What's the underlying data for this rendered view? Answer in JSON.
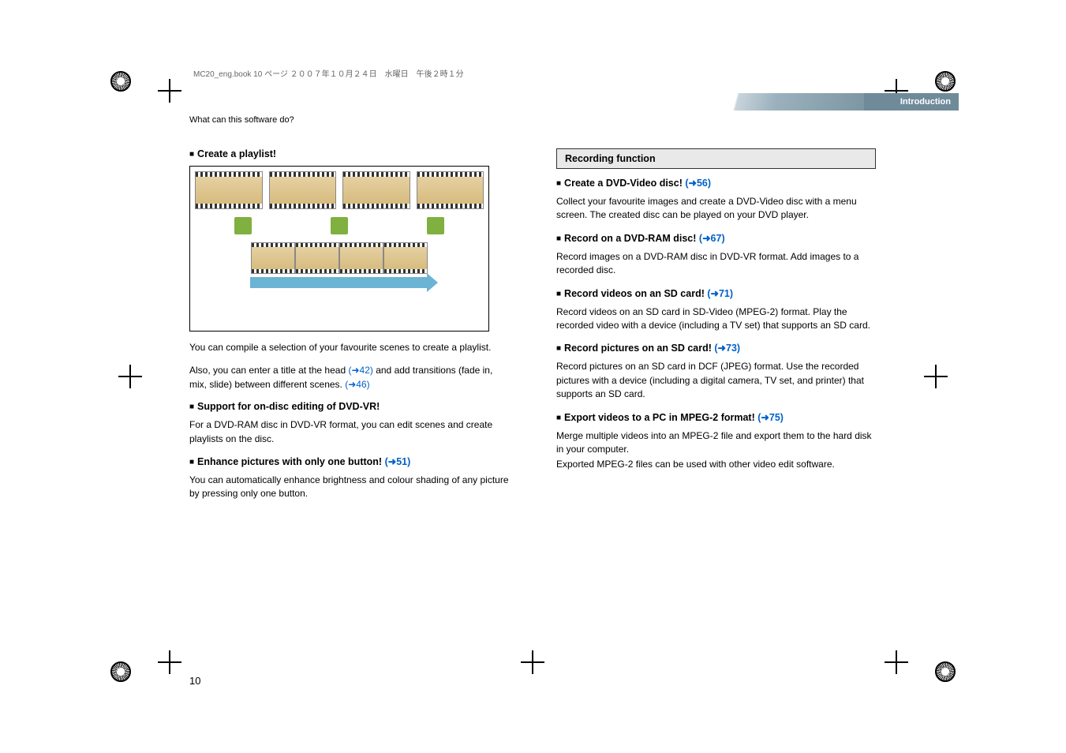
{
  "header_line": "MC20_eng.book  10 ページ  ２００７年１０月２４日　水曜日　午後２時１分",
  "banner_label": "Introduction",
  "breadcrumb": "What can this software do?",
  "page_number": "10",
  "left": {
    "h1": "Create a playlist!",
    "p1a": "You can compile a selection of your favourite scenes to create a playlist.",
    "p1b_pre": "Also, you can enter a title at the head ",
    "p1b_link1": "(➜42)",
    "p1b_mid": " and add transitions (fade in, mix, slide) between different scenes. ",
    "p1b_link2": "(➜46)",
    "h2": "Support for on-disc editing of DVD-VR!",
    "p2": "For a DVD-RAM disc in DVD-VR format, you can edit scenes and create playlists on the disc.",
    "h3_pre": "Enhance pictures with only one button! ",
    "h3_link": "(➜51)",
    "p3": "You can automatically enhance brightness and colour shading of any picture by pressing only one button."
  },
  "right": {
    "section_title": "Recording function",
    "h1_pre": "Create a DVD-Video disc! ",
    "h1_link": "(➜56)",
    "p1": "Collect your favourite images and create a DVD-Video disc with a menu screen. The created disc can be played on your DVD player.",
    "h2_pre": "Record on a DVD-RAM disc! ",
    "h2_link": "(➜67)",
    "p2": "Record images on a DVD-RAM disc in DVD-VR format. Add images to a recorded disc.",
    "h3_pre": "Record videos on an SD card! ",
    "h3_link": "(➜71)",
    "p3": "Record videos on an SD card in SD-Video (MPEG-2) format. Play the recorded video with a device (including a TV set) that supports an SD card.",
    "h4_pre": "Record pictures on an SD card! ",
    "h4_link": "(➜73)",
    "p4": "Record pictures on an SD card in DCF (JPEG) format. Use the recorded pictures with a device (including a digital camera, TV set, and printer) that supports an SD card.",
    "h5_pre": "Export videos to a PC in MPEG-2 format! ",
    "h5_link": "(➜75)",
    "p5a": "Merge multiple videos into an MPEG-2 file and export them to the hard disk in your computer.",
    "p5b": "Exported MPEG-2 files can be used with other video edit software."
  }
}
